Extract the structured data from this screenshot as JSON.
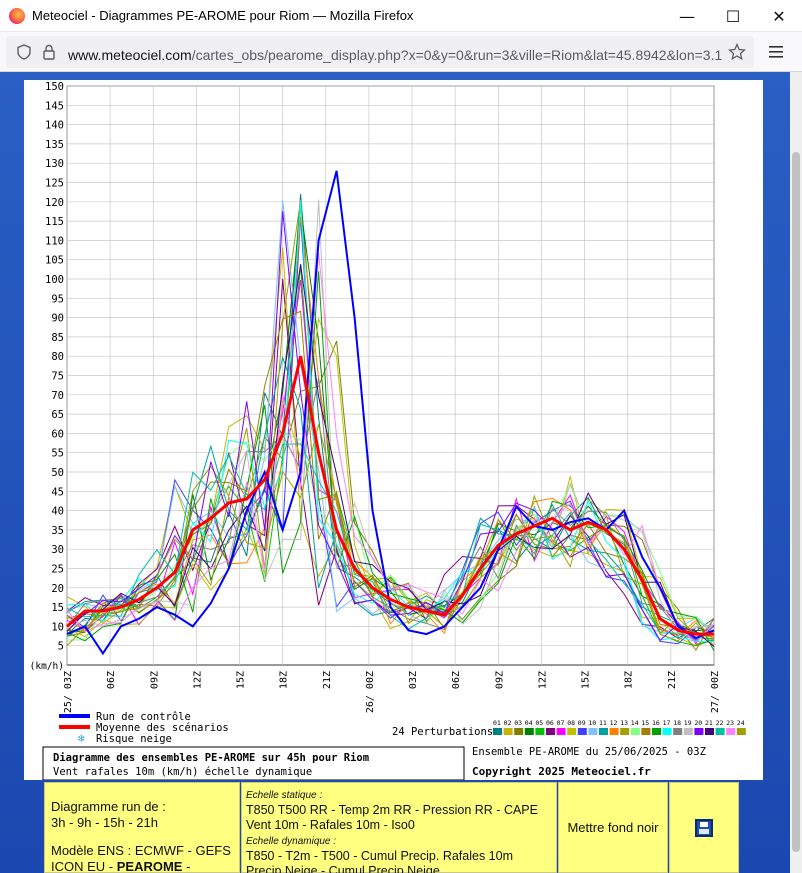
{
  "window": {
    "title": "Meteociel - Diagrammes PE-AROME pour Riom — Mozilla Firefox",
    "url_host": "www.meteociel.com",
    "url_path": "/cartes_obs/pearome_display.php?x=0&y=0&run=3&ville=Riom&lat=45.8942&lon=3.1",
    "minimize": "—",
    "maximize": "☐",
    "close": "✕"
  },
  "chart_data": {
    "type": "line",
    "title": "Diagramme des ensembles PE-AROME sur 45h pour Riom",
    "subtitle": "Vent rafales 10m (km/h) échelle dynamique",
    "ylabel": "(km/h)",
    "ylim": [
      0,
      150
    ],
    "yticks": [
      5,
      10,
      15,
      20,
      25,
      30,
      35,
      40,
      45,
      50,
      55,
      60,
      65,
      70,
      75,
      80,
      85,
      90,
      95,
      100,
      105,
      110,
      115,
      120,
      125,
      130,
      135,
      140,
      145,
      150
    ],
    "xticks": [
      "25/ 03Z",
      "06Z",
      "09Z",
      "12Z",
      "15Z",
      "18Z",
      "21Z",
      "26/ 00Z",
      "03Z",
      "06Z",
      "09Z",
      "12Z",
      "15Z",
      "18Z",
      "21Z",
      "27/ 00Z"
    ],
    "x_hours": [
      0,
      3,
      6,
      9,
      12,
      15,
      18,
      21,
      24,
      27,
      30,
      33,
      36,
      39,
      42,
      45
    ],
    "grid": true,
    "series": [
      {
        "name": "Run de contrôle",
        "color": "#0000ff",
        "values": [
          8,
          10,
          3,
          10,
          12,
          15,
          13,
          10,
          16,
          25,
          40,
          50,
          35,
          50,
          110,
          128,
          90,
          40,
          15,
          9,
          8,
          10,
          15,
          20,
          30,
          41,
          36,
          35,
          37,
          38,
          35,
          40,
          28,
          20,
          10,
          7,
          9
        ]
      },
      {
        "name": "Moyenne des scénarios",
        "color": "#ff0000",
        "values": [
          10,
          14,
          14,
          15,
          17,
          20,
          24,
          35,
          38,
          42,
          43,
          48,
          60,
          80,
          55,
          35,
          25,
          20,
          17,
          15,
          14,
          13,
          18,
          25,
          31,
          34,
          36,
          38,
          35,
          37,
          35,
          30,
          22,
          12,
          9,
          8,
          8
        ]
      }
    ],
    "perturbation_colors": [
      "#008080",
      "#c8b400",
      "#808000",
      "#008000",
      "#00c000",
      "#800080",
      "#ff00ff",
      "#c0c000",
      "#4040ff",
      "#80c0ff",
      "#00a0a0",
      "#ff8000",
      "#a0a000",
      "#80ff80",
      "#a08000",
      "#00a000",
      "#00ffff",
      "#808080",
      "#c0c0c0",
      "#8000ff",
      "#400080",
      "#00c0a0",
      "#ff80ff",
      "#a0a000"
    ],
    "legend": {
      "control": "Run de contrôle",
      "mean": "Moyenne des scénarios",
      "snow": "Risque neige",
      "perturbations": "24 Perturbations",
      "pert_numbers": [
        "01",
        "02",
        "03",
        "04",
        "05",
        "06",
        "07",
        "08",
        "09",
        "10",
        "11",
        "12",
        "13",
        "14",
        "15",
        "16",
        "17",
        "18",
        "19",
        "20",
        "21",
        "22",
        "23",
        "24"
      ]
    },
    "run_info": "Ensemble PE-AROME du 25/06/2025 - 03Z",
    "copyright": "Copyright 2025 Meteociel.fr"
  },
  "footer": {
    "run_title": "Diagramme run de :",
    "run_hours": "3h - 9h - 15h - 21h",
    "ens_title": "Modèle ENS :",
    "ens_line1": "ECMWF - GEFS",
    "ens_line2a": "ICON EU - ",
    "ens_line2b": "PEAROME",
    "ens_line2c": " - PEARP",
    "static_label": "Echelle statique :",
    "static_line1": "T850 T500 RR - Temp 2m RR - Pression RR - CAPE",
    "static_line2": "Vent 10m - Rafales 10m - Iso0",
    "dynamic_label": "Echelle dynamique :",
    "dynamic_line1": "T850 - T2m - T500 - Cumul Precip. Rafales 10m",
    "dynamic_line2": "Precip Neige - Cumul Precip Neige",
    "dark_mode": "Mettre fond noir",
    "save_icon": "floppy-disk-icon"
  }
}
